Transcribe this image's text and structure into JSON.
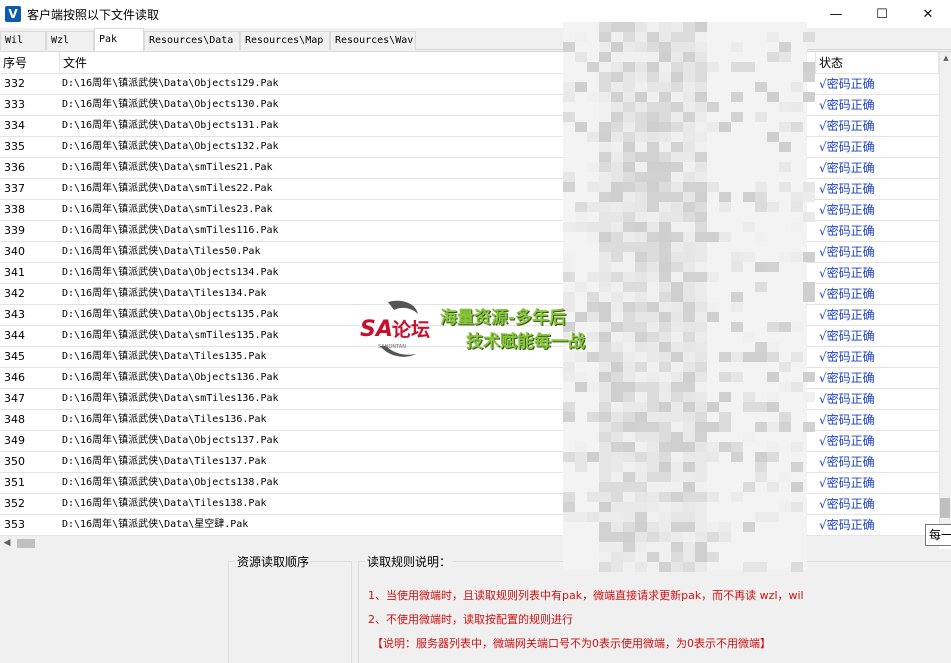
{
  "window": {
    "icon_letter": "V",
    "title": "客户端按照以下文件读取",
    "minimize": "—",
    "maximize": "☐",
    "close": "✕"
  },
  "tabs": [
    {
      "label": "Wil",
      "active": false
    },
    {
      "label": "Wzl",
      "active": false
    },
    {
      "label": "Pak",
      "active": true
    },
    {
      "label": "Resources\\Data",
      "active": false
    },
    {
      "label": "Resources\\Map",
      "active": false
    },
    {
      "label": "Resources\\Wav",
      "active": false
    }
  ],
  "table": {
    "headers": {
      "num": "序号",
      "file": "文件",
      "status": "状态"
    },
    "rows": [
      {
        "num": "332",
        "file": "D:\\16周年\\镇派武侠\\Data\\Objects129.Pak",
        "status": "√密码正确"
      },
      {
        "num": "333",
        "file": "D:\\16周年\\镇派武侠\\Data\\Objects130.Pak",
        "status": "√密码正确"
      },
      {
        "num": "334",
        "file": "D:\\16周年\\镇派武侠\\Data\\Objects131.Pak",
        "status": "√密码正确"
      },
      {
        "num": "335",
        "file": "D:\\16周年\\镇派武侠\\Data\\Objects132.Pak",
        "status": "√密码正确"
      },
      {
        "num": "336",
        "file": "D:\\16周年\\镇派武侠\\Data\\smTiles21.Pak",
        "status": "√密码正确"
      },
      {
        "num": "337",
        "file": "D:\\16周年\\镇派武侠\\Data\\smTiles22.Pak",
        "status": "√密码正确"
      },
      {
        "num": "338",
        "file": "D:\\16周年\\镇派武侠\\Data\\smTiles23.Pak",
        "status": "√密码正确"
      },
      {
        "num": "339",
        "file": "D:\\16周年\\镇派武侠\\Data\\smTiles116.Pak",
        "status": "√密码正确"
      },
      {
        "num": "340",
        "file": "D:\\16周年\\镇派武侠\\Data\\Tiles50.Pak",
        "status": "√密码正确"
      },
      {
        "num": "341",
        "file": "D:\\16周年\\镇派武侠\\Data\\Objects134.Pak",
        "status": "√密码正确"
      },
      {
        "num": "342",
        "file": "D:\\16周年\\镇派武侠\\Data\\Tiles134.Pak",
        "status": "√密码正确"
      },
      {
        "num": "343",
        "file": "D:\\16周年\\镇派武侠\\Data\\Objects135.Pak",
        "status": "√密码正确"
      },
      {
        "num": "344",
        "file": "D:\\16周年\\镇派武侠\\Data\\smTiles135.Pak",
        "status": "√密码正确"
      },
      {
        "num": "345",
        "file": "D:\\16周年\\镇派武侠\\Data\\Tiles135.Pak",
        "status": "√密码正确"
      },
      {
        "num": "346",
        "file": "D:\\16周年\\镇派武侠\\Data\\Objects136.Pak",
        "status": "√密码正确"
      },
      {
        "num": "347",
        "file": "D:\\16周年\\镇派武侠\\Data\\smTiles136.Pak",
        "status": "√密码正确"
      },
      {
        "num": "348",
        "file": "D:\\16周年\\镇派武侠\\Data\\Tiles136.Pak",
        "status": "√密码正确"
      },
      {
        "num": "349",
        "file": "D:\\16周年\\镇派武侠\\Data\\Objects137.Pak",
        "status": "√密码正确"
      },
      {
        "num": "350",
        "file": "D:\\16周年\\镇派武侠\\Data\\Tiles137.Pak",
        "status": "√密码正确"
      },
      {
        "num": "351",
        "file": "D:\\16周年\\镇派武侠\\Data\\Objects138.Pak",
        "status": "√密码正确"
      },
      {
        "num": "352",
        "file": "D:\\16周年\\镇派武侠\\Data\\Tiles138.Pak",
        "status": "√密码正确"
      },
      {
        "num": "353",
        "file": "D:\\16周年\\镇派武侠\\Data\\星空肆.Pak",
        "status": "√密码正确"
      }
    ]
  },
  "tooltip": "每一",
  "bottom": {
    "order_title": "资源读取顺序",
    "rules_title": "读取规则说明：",
    "rules": [
      "1、当使用微端时，且读取规则列表中有pak，微端直接请求更新pak，而不再读 wzl，wil",
      "2、不使用微端时，读取按配置的规则进行",
      "【说明：服务器列表中，微端网关端口号不为0表示使用微端，为0表示不用微端】"
    ]
  },
  "watermark": {
    "logo_text": "SA论坛",
    "logo_sub": "SAHONTAN",
    "line1": "海量资源-多年后",
    "line2": "技术赋能每一战"
  },
  "colors": {
    "status_blue": "#1a3fc4",
    "rule_red": "#d01010",
    "watermark_green": "#8cc63f",
    "logo_red": "#c8102e"
  }
}
